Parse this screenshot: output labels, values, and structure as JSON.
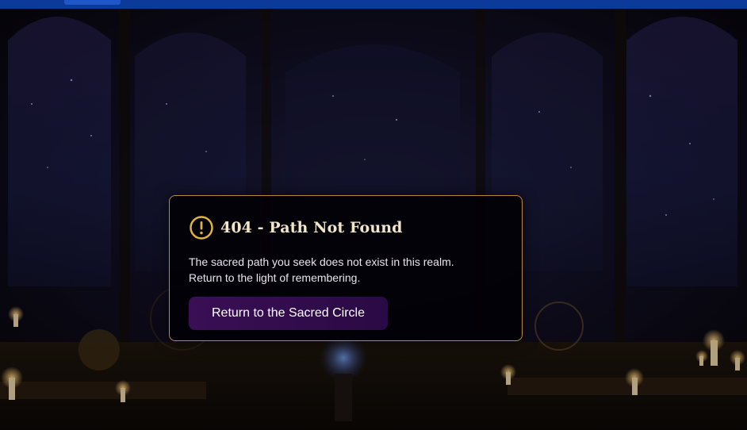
{
  "error": {
    "icon": "alert-circle-icon",
    "title": "404 - Path Not Found",
    "message_line1": "The sacred path you seek does not exist in this realm.",
    "message_line2": "Return to the light of remembering.",
    "button_label": "Return to the Sacred Circle"
  },
  "colors": {
    "topbar": "#0c3a9a",
    "dialog_border": "#b98a3a",
    "icon": "#e2b33a",
    "title_text": "#f2e6c9",
    "button_bg": "#3a0f55"
  }
}
